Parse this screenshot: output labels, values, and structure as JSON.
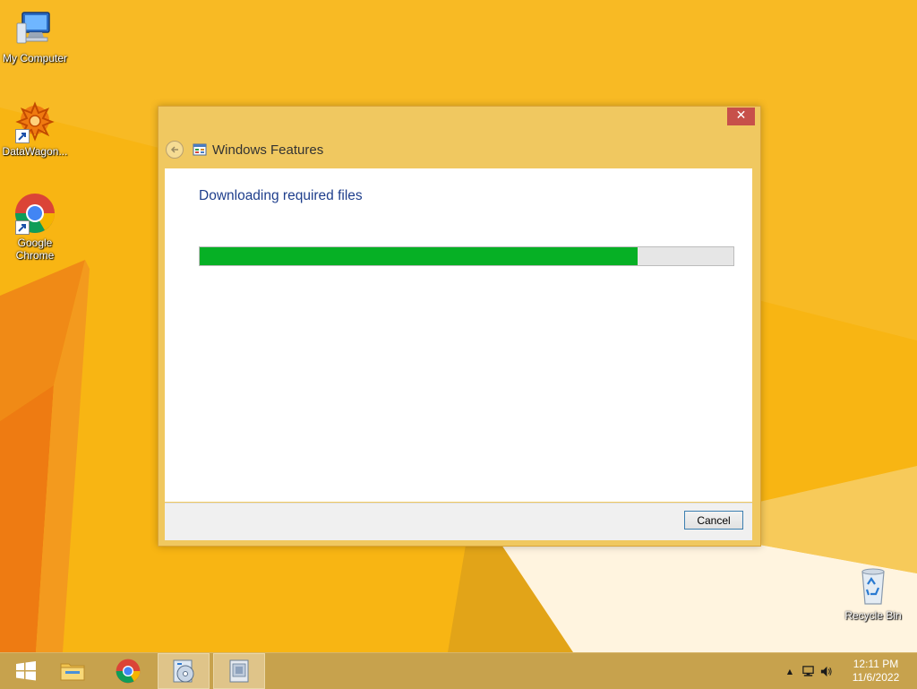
{
  "desktop": {
    "icons": [
      {
        "label": "My Computer",
        "icon": "computer-icon"
      },
      {
        "label": "DataWagon...",
        "icon": "datawagon-icon"
      },
      {
        "label": "Google Chrome",
        "icon": "chrome-icon"
      },
      {
        "label": "Recycle Bin",
        "icon": "recycle-bin-icon"
      }
    ]
  },
  "dialog": {
    "title": "Windows Features",
    "close_label": "✕",
    "heading": "Downloading required files",
    "progress_fraction": 0.82,
    "cancel_label": "Cancel"
  },
  "taskbar": {
    "items": [
      "start-button",
      "file-explorer",
      "google-chrome",
      "setup-disc",
      "windows-features"
    ],
    "active_item": "windows-features",
    "tray": {
      "show_hidden_label": "▲",
      "time": "12:11 PM",
      "date": "11/6/2022"
    }
  },
  "colors": {
    "desktop": "#f7b30f",
    "progress": "#06b025",
    "heading": "#1e3e8c",
    "close": "#c7504a"
  }
}
